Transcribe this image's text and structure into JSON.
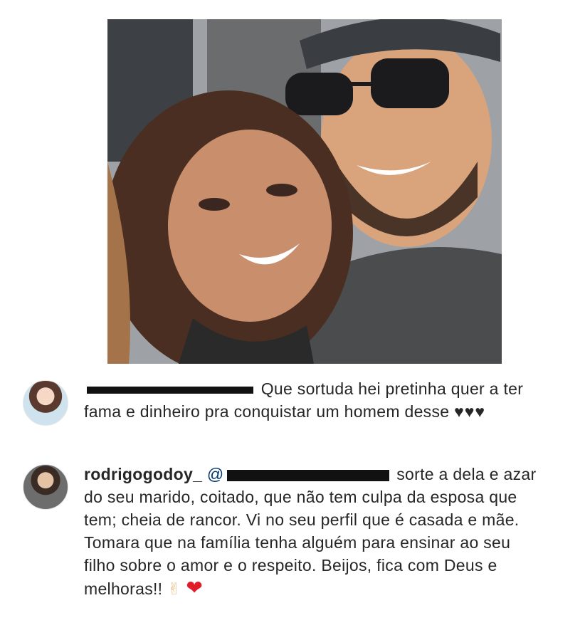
{
  "photo": {
    "description_icon": "photo-icon"
  },
  "comments": [
    {
      "avatar_icon": "avatar-woman-icon",
      "text": "Que sortuda hei pretinha quer a ter fama e dinheiro pra conquistar um homem desse",
      "emoji": "♥♥♥"
    },
    {
      "avatar_icon": "avatar-man-icon",
      "username": "rodrigogodoy_",
      "mention_prefix": "@",
      "text": "sorte a dela e azar do seu marido, coitado, que não tem culpa da esposa que tem; cheia de rancor. Vi no seu perfil que é casada e mãe. Tomara que na família tenha alguém para ensinar ao seu filho sobre o amor e o respeito. Beijos, fica com Deus e melhoras!!",
      "emoji_hand": "✌",
      "emoji_heart": "❤"
    }
  ],
  "colors": {
    "text": "#262626",
    "mention": "#00376b",
    "heart": "#e21b2a",
    "redaction": "#111111"
  }
}
